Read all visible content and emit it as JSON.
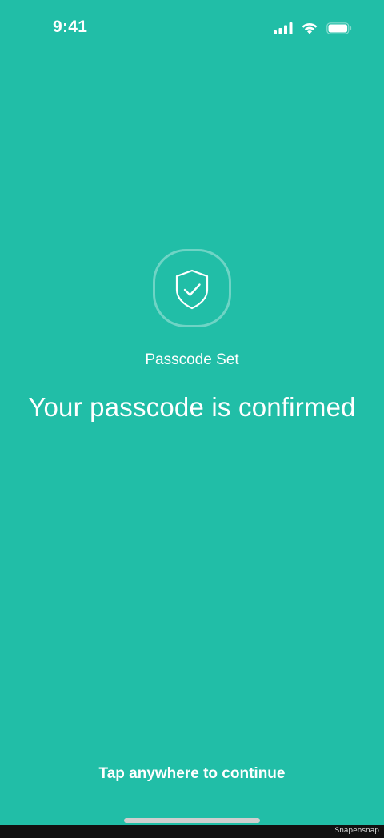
{
  "status_bar": {
    "time": "9:41",
    "icons": [
      "cellular-signal-icon",
      "wifi-icon",
      "battery-icon"
    ]
  },
  "main": {
    "badge_icon": "shield-check-icon",
    "label": "Passcode Set",
    "title": "Your passcode is confirmed",
    "hint": "Tap anywhere to continue"
  },
  "footer": {
    "watermark": "Snapensnap"
  },
  "colors": {
    "background": "#21bea7",
    "text": "#ffffff",
    "home_indicator": "#cfcfcf",
    "footer_strip": "#111111"
  }
}
